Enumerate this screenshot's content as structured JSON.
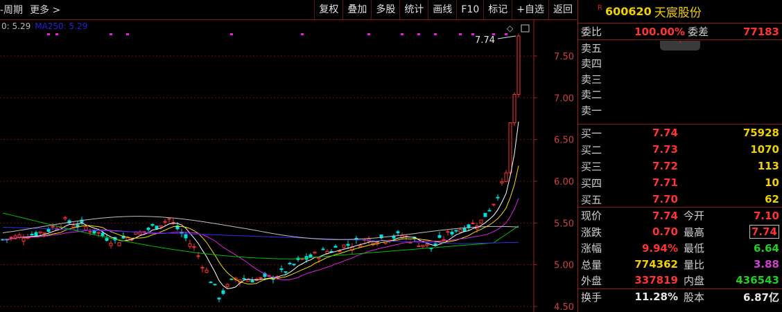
{
  "toolbar": {
    "left_items": [
      "-周期",
      "更多 >"
    ],
    "buttons": [
      "复权",
      "叠加",
      "多股",
      "统计",
      "画线",
      "F10",
      "标记",
      "+自选",
      "返回"
    ]
  },
  "ma": {
    "ma_text": "0: 5.29",
    "ma250": "MA250: 5.29"
  },
  "chart": {
    "y_ticks": [
      {
        "value": 7.5,
        "label": "7.50"
      },
      {
        "value": 7.0,
        "label": "7.00"
      },
      {
        "value": 6.5,
        "label": "6.50"
      },
      {
        "value": 6.0,
        "label": "6.00"
      },
      {
        "value": 5.5,
        "label": "5.50"
      },
      {
        "value": 5.0,
        "label": "5.00"
      },
      {
        "value": 4.5,
        "label": "4.50"
      }
    ],
    "ylim": [
      4.5,
      7.85
    ],
    "high_marker": "7.74",
    "colors": {
      "up": "#ff3333",
      "down": "#00e0e0",
      "ma5": "#ffffff",
      "ma10": "#f0e000",
      "ma20": "#e020e0",
      "ma60": "#00c000",
      "ma120": "#3030e0",
      "ma250": "#c0c0c0"
    }
  },
  "stock": {
    "r_flag": "R",
    "code": "600620",
    "name": "天宸股份"
  },
  "weibi": {
    "label": "委比",
    "value": "100.00%",
    "label2": "委差",
    "value2": "77183"
  },
  "sell": [
    {
      "label": "卖五"
    },
    {
      "label": "卖四"
    },
    {
      "label": "卖三"
    },
    {
      "label": "卖二"
    },
    {
      "label": "卖一"
    }
  ],
  "buy": [
    {
      "label": "买一",
      "price": "7.74",
      "vol": "75928"
    },
    {
      "label": "买二",
      "price": "7.73",
      "vol": "1070"
    },
    {
      "label": "买三",
      "price": "7.72",
      "vol": "113"
    },
    {
      "label": "买四",
      "price": "7.71",
      "vol": "10"
    },
    {
      "label": "买五",
      "price": "7.70",
      "vol": "62"
    }
  ],
  "quote": [
    {
      "l1": "现价",
      "v1": "7.74",
      "c1": "red",
      "l2": "今开",
      "v2": "7.10",
      "c2": "red"
    },
    {
      "l1": "涨跌",
      "v1": "0.70",
      "c1": "red",
      "l2": "最高",
      "v2": "7.74",
      "c2": "red"
    },
    {
      "l1": "涨幅",
      "v1": "9.94%",
      "c1": "red",
      "l2": "最低",
      "v2": "6.64",
      "c2": "grn"
    },
    {
      "l1": "总量",
      "v1": "774362",
      "c1": "yel",
      "l2": "量比",
      "v2": "3.88",
      "c2": "pur"
    },
    {
      "l1": "外盘",
      "v1": "337819",
      "c1": "red",
      "l2": "内盘",
      "v2": "436543",
      "c2": "grn"
    },
    {
      "l1": "换手",
      "v1": "11.28%",
      "c1": "wht",
      "l2": "股本",
      "v2": "6.87亿",
      "c2": "wht"
    }
  ]
}
